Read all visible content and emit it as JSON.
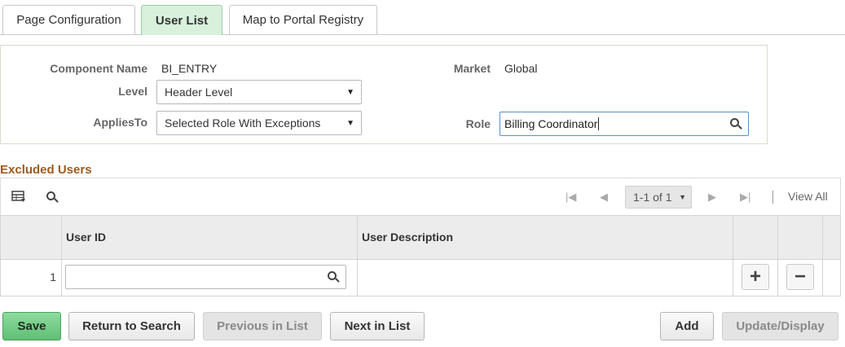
{
  "tabs": {
    "page_configuration": "Page Configuration",
    "user_list": "User List",
    "map_to_portal_registry": "Map to Portal Registry"
  },
  "form": {
    "component_name_label": "Component Name",
    "component_name_value": "BI_ENTRY",
    "market_label": "Market",
    "market_value": "Global",
    "level_label": "Level",
    "level_value": "Header Level",
    "applies_to_label": "AppliesTo",
    "applies_to_value": "Selected Role With Exceptions",
    "role_label": "Role",
    "role_value": "Billing Coordinator"
  },
  "excluded_users": {
    "title": "Excluded Users",
    "pager": "1-1 of 1",
    "view_all": "View All",
    "columns": {
      "user_id": "User ID",
      "user_description": "User Description"
    },
    "rows": [
      {
        "row_number": "1",
        "user_id": "",
        "user_description": ""
      }
    ]
  },
  "buttons": {
    "save": "Save",
    "return_to_search": "Return to Search",
    "previous_in_list": "Previous in List",
    "next_in_list": "Next in List",
    "add": "Add",
    "update_display": "Update/Display"
  },
  "icons": {
    "grid_personalize": "grid-personalize-icon",
    "search": "search-icon",
    "first": "first-page-icon",
    "previous": "previous-page-icon",
    "next": "next-page-icon",
    "last": "last-page-icon",
    "add_row": "plus-icon",
    "delete_row": "minus-icon"
  },
  "colors": {
    "active_tab": "#d8f0dc",
    "section_title": "#9d5a1f",
    "primary_button": "#5fbf74"
  }
}
